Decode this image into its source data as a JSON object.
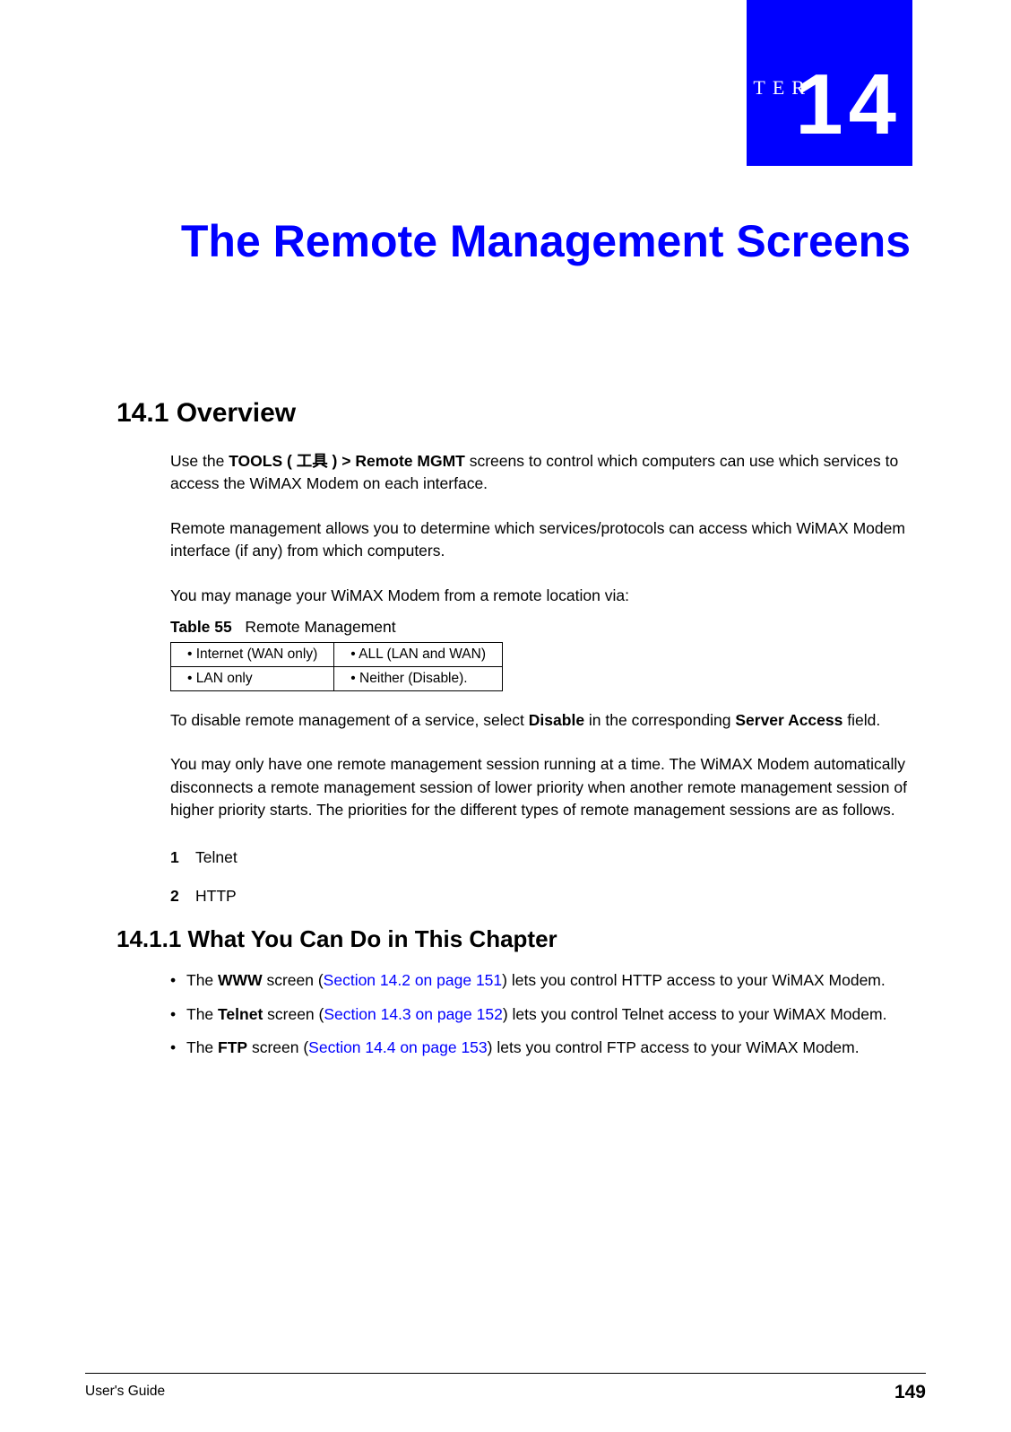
{
  "chapter": {
    "tab_prefix": "CHAPTER",
    "number": "14",
    "title": "The Remote Management Screens"
  },
  "section_14_1": {
    "heading": "14.1  Overview",
    "p1_pre": "Use the ",
    "p1_bold": "TOOLS ( 工具 ) > Remote MGMT",
    "p1_post": " screens to control which computers can use which services to access the WiMAX Modem on each interface.",
    "p2": "Remote management allows you to determine which services/protocols can access which WiMAX Modem interface (if any) from which computers.",
    "p3": "You may manage your WiMAX Modem from a remote location via:",
    "table": {
      "label": "Table 55",
      "caption": "Remote Management",
      "r1c1": "Internet (WAN only)",
      "r1c2": "ALL (LAN and WAN)",
      "r2c1": "LAN only",
      "r2c2": "Neither (Disable)."
    },
    "p4_pre": "To disable remote management of a service, select ",
    "p4_bold1": "Disable",
    "p4_mid": " in the corresponding ",
    "p4_bold2": "Server Access",
    "p4_post": " field.",
    "p5": "You may only have one remote management session running at a time. The WiMAX Modem automatically disconnects a remote management session of lower priority when another remote management session of higher priority starts. The priorities for the different types of remote management sessions are as follows.",
    "list": {
      "n1": "1",
      "i1": "Telnet",
      "n2": "2",
      "i2": "HTTP"
    }
  },
  "section_14_1_1": {
    "heading": "14.1.1  What You Can Do in This Chapter",
    "b1_pre": "The ",
    "b1_bold": "WWW",
    "b1_mid": " screen (",
    "b1_link": "Section 14.2 on page 151",
    "b1_post": ") lets you control HTTP access to your WiMAX Modem.",
    "b2_pre": "The ",
    "b2_bold": "Telnet",
    "b2_mid": " screen (",
    "b2_link": "Section 14.3 on page 152",
    "b2_post": ") lets you control Telnet access to your WiMAX Modem.",
    "b3_pre": "The ",
    "b3_bold": "FTP",
    "b3_mid": " screen (",
    "b3_link": "Section 14.4 on page 153",
    "b3_post": ") lets you control FTP access to your WiMAX Modem."
  },
  "footer": {
    "left": "User's Guide",
    "page": "149"
  }
}
